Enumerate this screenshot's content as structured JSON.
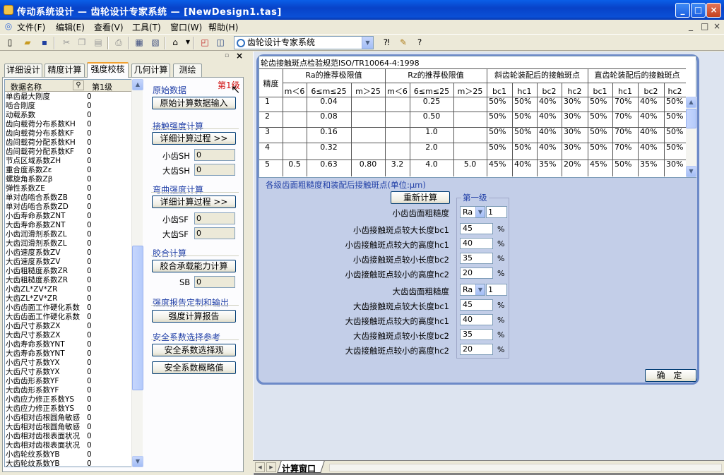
{
  "window": {
    "title": "传动系统设计 — 齿轮设计专家系统 — [NewDesign1.tas]",
    "min": "_",
    "max": "□",
    "close": "×"
  },
  "menu": [
    "文件(F)",
    "编辑(E)",
    "查看(V)",
    "工具(T)",
    "窗口(W)",
    "帮助(H)"
  ],
  "mdi_controls": [
    "_",
    "□",
    "×"
  ],
  "toolbar": {
    "module_select": "齿轮设计专家系统"
  },
  "left": {
    "tabs": [
      "详细设计",
      "精度计算",
      "强度校核",
      "几何计算",
      "测绘"
    ],
    "active_tab": 2,
    "grid": {
      "col_name": "数据名称",
      "col_value": "第1级",
      "rows": [
        [
          "单齿最大刚度",
          "0"
        ],
        [
          "啮合刚度",
          "0"
        ],
        [
          "动载系数",
          "0"
        ],
        [
          "齿向载荷分布系数KH",
          "0"
        ],
        [
          "齿向载荷分布系数KF",
          "0"
        ],
        [
          "齿间载荷分配系数KH",
          "0"
        ],
        [
          "齿间载荷分配系数KF",
          "0"
        ],
        [
          "节点区域系数ZH",
          "0"
        ],
        [
          "重合度系数Zε",
          "0"
        ],
        [
          "螺旋角系数Zβ",
          "0"
        ],
        [
          "弹性系数ZE",
          "0"
        ],
        [
          "单对齿啮合系数ZB",
          "0"
        ],
        [
          "单对齿啮合系数ZD",
          "0"
        ],
        [
          "小齿寿命系数ZNT",
          "0"
        ],
        [
          "大齿寿命系数ZNT",
          "0"
        ],
        [
          "小齿润滑剂系数ZL",
          "0"
        ],
        [
          "大齿润滑剂系数ZL",
          "0"
        ],
        [
          "小齿速度系数ZV",
          "0"
        ],
        [
          "大齿速度系数ZV",
          "0"
        ],
        [
          "小齿粗糙度系数ZR",
          "0"
        ],
        [
          "大齿粗糙度系数ZR",
          "0"
        ],
        [
          "小齿ZL*ZV*ZR",
          "0"
        ],
        [
          "大齿ZL*ZV*ZR",
          "0"
        ],
        [
          "小齿齿面工作硬化系数",
          "0"
        ],
        [
          "大齿齿面工作硬化系数",
          "0"
        ],
        [
          "小齿尺寸系数ZX",
          "0"
        ],
        [
          "大齿尺寸系数ZX",
          "0"
        ],
        [
          "小齿寿命系数YNT",
          "0"
        ],
        [
          "大齿寿命系数YNT",
          "0"
        ],
        [
          "小齿尺寸系数YX",
          "0"
        ],
        [
          "大齿尺寸系数YX",
          "0"
        ],
        [
          "小齿齿形系数YF",
          "0"
        ],
        [
          "大齿齿形系数YF",
          "0"
        ],
        [
          "小齿应力修正系数YS",
          "0"
        ],
        [
          "大齿应力修正系数YS",
          "0"
        ],
        [
          "小齿相对齿根圆角敏感",
          "0"
        ],
        [
          "大齿相对齿根圆角敏感",
          "0"
        ],
        [
          "小齿相对齿根表面状况",
          "0"
        ],
        [
          "大齿相对齿根表面状况",
          "0"
        ],
        [
          "小齿轮纹系数YB",
          "0"
        ],
        [
          "大齿轮纹系数YB",
          "0"
        ]
      ]
    },
    "grade_red": "第1级",
    "sections": {
      "orig": {
        "title": "原始数据",
        "btn": "原始计算数据输入"
      },
      "contact": {
        "title": "接触强度计算",
        "btn": "详细计算过程  >>",
        "sh_small_label": "小齿SH",
        "sh_small": "0",
        "sh_big_label": "大齿SH",
        "sh_big": "0"
      },
      "bending": {
        "title": "弯曲强度计算",
        "btn": "详细计算过程  >>",
        "sf_small_label": "小齿SF",
        "sf_small": "0",
        "sf_big_label": "大齿SF",
        "sf_big": "0"
      },
      "glue": {
        "title": "胶合计算",
        "btn": "胶合承载能力计算",
        "sb_label": "SB",
        "sb": "0"
      },
      "report": {
        "title": "强度报告定制和输出",
        "btn": "强度计算报告"
      },
      "safety": {
        "title": "安全系数选择参考",
        "btn1": "安全系数选择观",
        "btn2": "安全系数概略值"
      }
    }
  },
  "dialog": {
    "table_title": "轮齿接触斑点检验规范ISO/TR10064-4:1998",
    "head": {
      "precision": "精度",
      "ra": "Ra的推荐极限值",
      "rz": "Rz的推荐极限值",
      "helical": "斜齿轮装配后的接触斑点",
      "spur": "直齿轮装配后的接触斑点",
      "m_lt6": "m＜6",
      "m_6_25": "6≤m≤25",
      "m_gt25": "m＞25",
      "bc1": "bc1",
      "hc1": "hc1",
      "bc2": "bc2",
      "hc2": "hc2"
    },
    "rows": [
      [
        "1",
        "",
        "0.04",
        "",
        "",
        "0.25",
        "",
        "50%",
        "50%",
        "40%",
        "30%",
        "50%",
        "70%",
        "40%",
        "50%"
      ],
      [
        "2",
        "",
        "0.08",
        "",
        "",
        "0.50",
        "",
        "50%",
        "50%",
        "40%",
        "30%",
        "50%",
        "70%",
        "40%",
        "50%"
      ],
      [
        "3",
        "",
        "0.16",
        "",
        "",
        "1.0",
        "",
        "50%",
        "50%",
        "40%",
        "30%",
        "50%",
        "70%",
        "40%",
        "50%"
      ],
      [
        "4",
        "",
        "0.32",
        "",
        "",
        "2.0",
        "",
        "50%",
        "50%",
        "40%",
        "30%",
        "50%",
        "70%",
        "40%",
        "50%"
      ],
      [
        "5",
        "0.5",
        "0.63",
        "0.80",
        "3.2",
        "4.0",
        "5.0",
        "45%",
        "40%",
        "35%",
        "20%",
        "45%",
        "50%",
        "35%",
        "30%"
      ]
    ],
    "sub_title": "各级齿面粗糙度和装配后接触斑点(单位:μm)",
    "recalc": "重新计算",
    "grade": "第一级",
    "small": {
      "rough_label": "小齿齿面粗糙度",
      "rough_type": "Ra",
      "rough_val": "1",
      "bc1_label": "小齿接触斑点较大长度bc1",
      "bc1": "45",
      "hc1_label": "小齿接触斑点较大的高度hc1",
      "hc1": "40",
      "bc2_label": "小齿接触斑点较小长度bc2",
      "bc2": "35",
      "hc2_label": "小齿接触斑点较小的高度hc2",
      "hc2": "20"
    },
    "big": {
      "rough_label": "大齿齿面粗糙度",
      "rough_type": "Ra",
      "rough_val": "1",
      "bc1_label": "大齿接触斑点较大长度bc1",
      "bc1": "45",
      "hc1_label": "大齿接触斑点较大的高度hc1",
      "hc1": "40",
      "bc2_label": "大齿接触斑点较小长度bc2",
      "bc2": "35",
      "hc2_label": "大齿接触斑点较小的高度hc2",
      "hc2": "20"
    },
    "percent": "%",
    "ok": "确 定"
  },
  "bottom": {
    "tab": "计算窗口"
  },
  "colors": {
    "title_blue": "#0842c8",
    "section_blue": "#1f3ea6",
    "dialog_border": "#6d8ac8",
    "dialog_bg": "#c3cee8",
    "red": "#d01010"
  }
}
